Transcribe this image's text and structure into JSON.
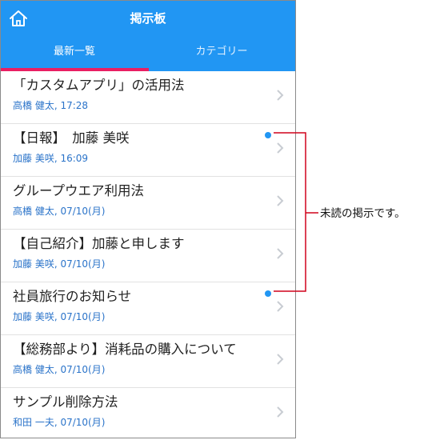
{
  "header": {
    "title": "掲示板",
    "home_icon": "home-icon"
  },
  "tabs": [
    {
      "label": "最新一覧",
      "selected": true
    },
    {
      "label": "カテゴリー",
      "selected": false
    }
  ],
  "colors": {
    "header_bg": "#2196f3",
    "tab_indicator": "#e91e63",
    "unread_dot": "#2196f3",
    "callout_line": "#d0021b",
    "meta_text": "#2a73c9"
  },
  "items": [
    {
      "title": "「カスタムアプリ」の活用法",
      "meta": "高橋 健太, 17:28",
      "unread": false
    },
    {
      "title": "【日報】　加藤 美咲",
      "meta": "加藤 美咲, 16:09",
      "unread": true
    },
    {
      "title": "グループウエア利用法",
      "meta": "高橋 健太, 07/10(月)",
      "unread": false
    },
    {
      "title": "【自己紹介】加藤と申します",
      "meta": "加藤 美咲, 07/10(月)",
      "unread": false
    },
    {
      "title": "社員旅行のお知らせ",
      "meta": "加藤 美咲, 07/10(月)",
      "unread": true
    },
    {
      "title": "【総務部より】消耗品の購入について",
      "meta": "高橋 健太, 07/10(月)",
      "unread": false
    },
    {
      "title": "サンプル削除方法",
      "meta": "和田 一夫, 07/10(月)",
      "unread": false
    }
  ],
  "callout": {
    "text": "未読の掲示です。"
  }
}
